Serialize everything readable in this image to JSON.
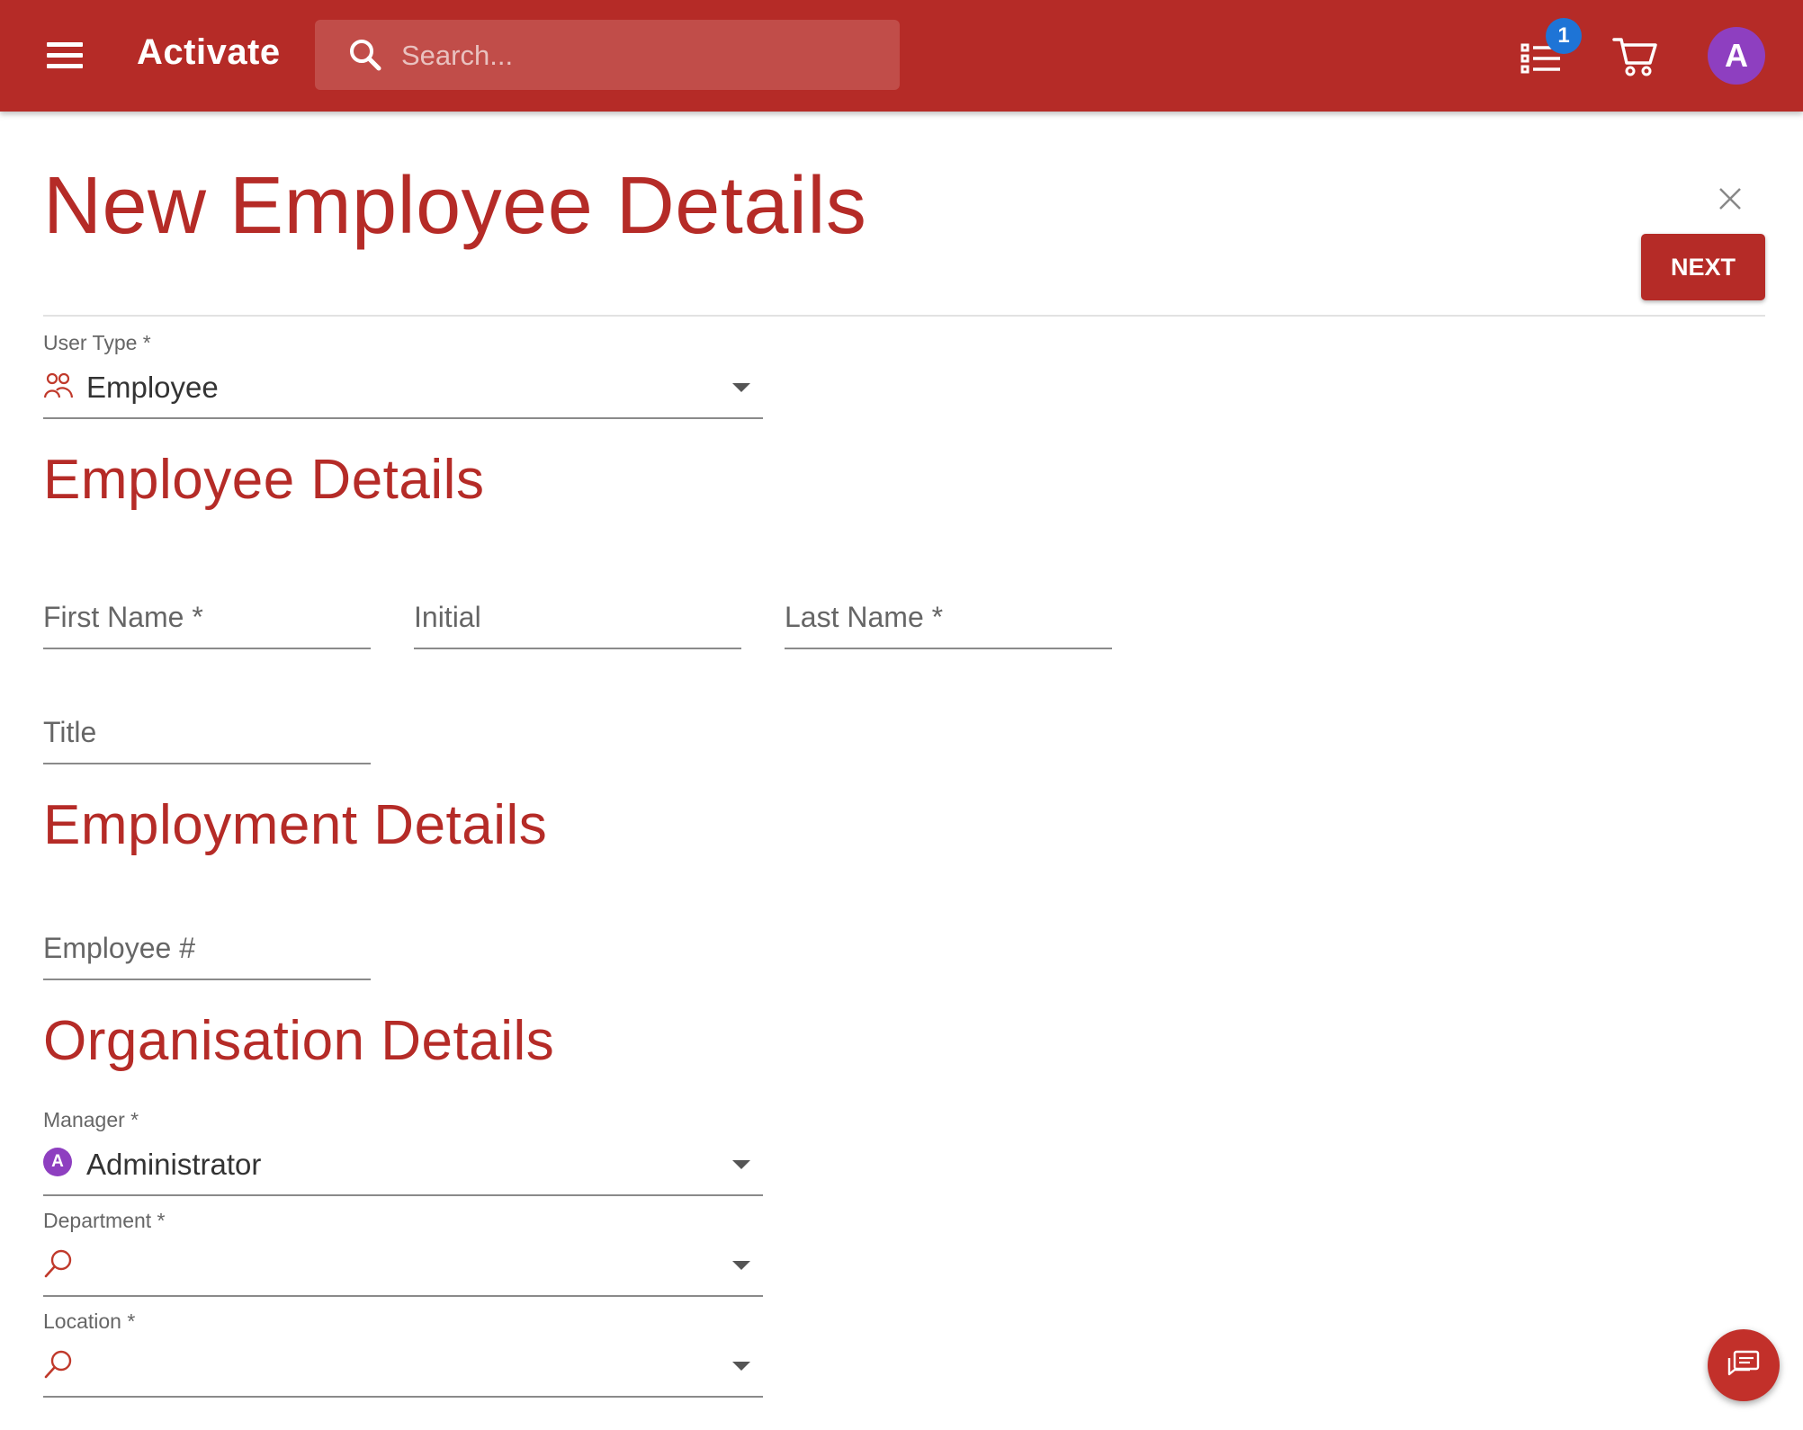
{
  "header": {
    "app_title": "Activate",
    "search_placeholder": "Search...",
    "tasks_badge": "1",
    "avatar_initial": "A"
  },
  "page": {
    "title": "New Employee Details",
    "next_label": "NEXT"
  },
  "user_type": {
    "label": "User Type *",
    "value": "Employee"
  },
  "employee_details": {
    "heading": "Employee Details",
    "first_name": "First Name *",
    "initial": "Initial",
    "last_name": "Last Name *",
    "title": "Title"
  },
  "employment_details": {
    "heading": "Employment Details",
    "employee_number": "Employee #"
  },
  "organisation_details": {
    "heading": "Organisation Details",
    "manager_label": "Manager *",
    "manager_value": "Administrator",
    "manager_initial": "A",
    "department_label": "Department *",
    "location_label": "Location *"
  },
  "icons": {
    "menu": "menu-icon",
    "search": "search-icon",
    "tasks": "task-list-icon",
    "cart": "cart-icon",
    "close": "close-icon",
    "people": "people-icon",
    "chat": "chat-icon"
  },
  "colors": {
    "brand": "#b52b27",
    "badge": "#1e74d6",
    "avatar": "#8e3fc0"
  }
}
